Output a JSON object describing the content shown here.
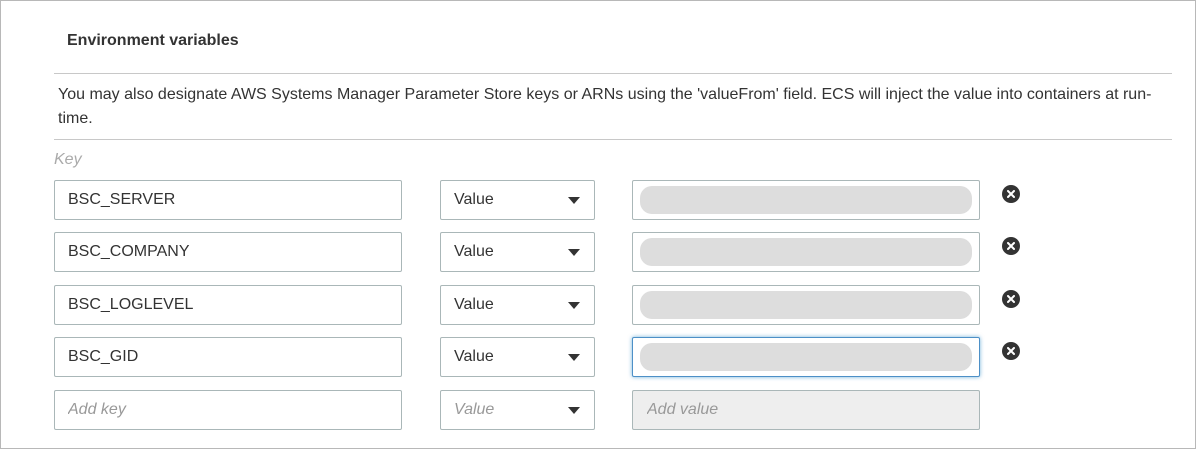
{
  "section": {
    "title": "Environment variables",
    "description": "You may also designate AWS Systems Manager Parameter Store keys or ARNs using the 'valueFrom' field. ECS will inject the value into containers at run-time.",
    "key_header": "Key"
  },
  "rows": [
    {
      "key": "BSC_SERVER",
      "type": "Value",
      "value_masked": true,
      "remove_icon": "close-circle-icon"
    },
    {
      "key": "BSC_COMPANY",
      "type": "Value",
      "value_masked": true,
      "remove_icon": "close-circle-icon"
    },
    {
      "key": "BSC_LOGLEVEL",
      "type": "Value",
      "value_masked": true,
      "remove_icon": "close-circle-icon"
    },
    {
      "key": "BSC_GID",
      "type": "Value",
      "value_masked": true,
      "focused": true,
      "remove_icon": "close-circle-icon"
    }
  ],
  "new_row": {
    "key_placeholder": "Add key",
    "type_placeholder": "Value",
    "value_placeholder": "Add value"
  },
  "colors": {
    "border": "#aab7b8",
    "focus": "#4d90c7",
    "mask": "#dddddd",
    "icon": "#333333"
  }
}
